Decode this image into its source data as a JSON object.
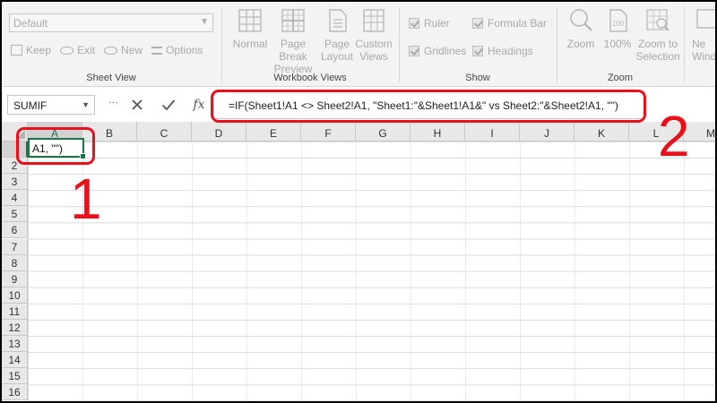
{
  "ribbon": {
    "sheet_view": {
      "select_value": "Default",
      "keep_label": "Keep",
      "exit_label": "Exit",
      "new_label": "New",
      "options_label": "Options",
      "group_label": "Sheet View"
    },
    "workbook_views": {
      "normal_label": "Normal",
      "page_break_label_1": "Page Break",
      "page_break_label_2": "Preview",
      "page_layout_label_1": "Page",
      "page_layout_label_2": "Layout",
      "custom_views_label_1": "Custom",
      "custom_views_label_2": "Views",
      "group_label": "Workbook Views"
    },
    "show": {
      "ruler_label": "Ruler",
      "formula_bar_label": "Formula Bar",
      "gridlines_label": "Gridlines",
      "headings_label": "Headings",
      "group_label": "Show"
    },
    "zoom": {
      "zoom_label": "Zoom",
      "zoom100_label": "100%",
      "zoom_sel_label_1": "Zoom to",
      "zoom_sel_label_2": "Selection",
      "group_label": "Zoom"
    },
    "window": {
      "new_window_label_1": "Ne",
      "new_window_label_2": "Wind"
    }
  },
  "formula_bar": {
    "name_box": "SUMIF",
    "fx_label": "fx",
    "formula": "=IF(Sheet1!A1 <> Sheet2!A1, \"Sheet1:\"&Sheet1!A1&\" vs Sheet2:\"&Sheet2!A1, \"\")"
  },
  "grid": {
    "columns": [
      "A",
      "B",
      "C",
      "D",
      "E",
      "F",
      "G",
      "H",
      "I",
      "J",
      "K",
      "L",
      "M"
    ],
    "rows": [
      "2",
      "3",
      "4",
      "5",
      "6",
      "7",
      "8",
      "9",
      "10",
      "11",
      "12",
      "13",
      "14",
      "15",
      "16"
    ],
    "active_cell_text": "A1, \"\")"
  },
  "annotations": {
    "label_1": "1",
    "label_2": "2",
    "color": "#e8101a"
  },
  "colors": {
    "accent": "#217346"
  }
}
